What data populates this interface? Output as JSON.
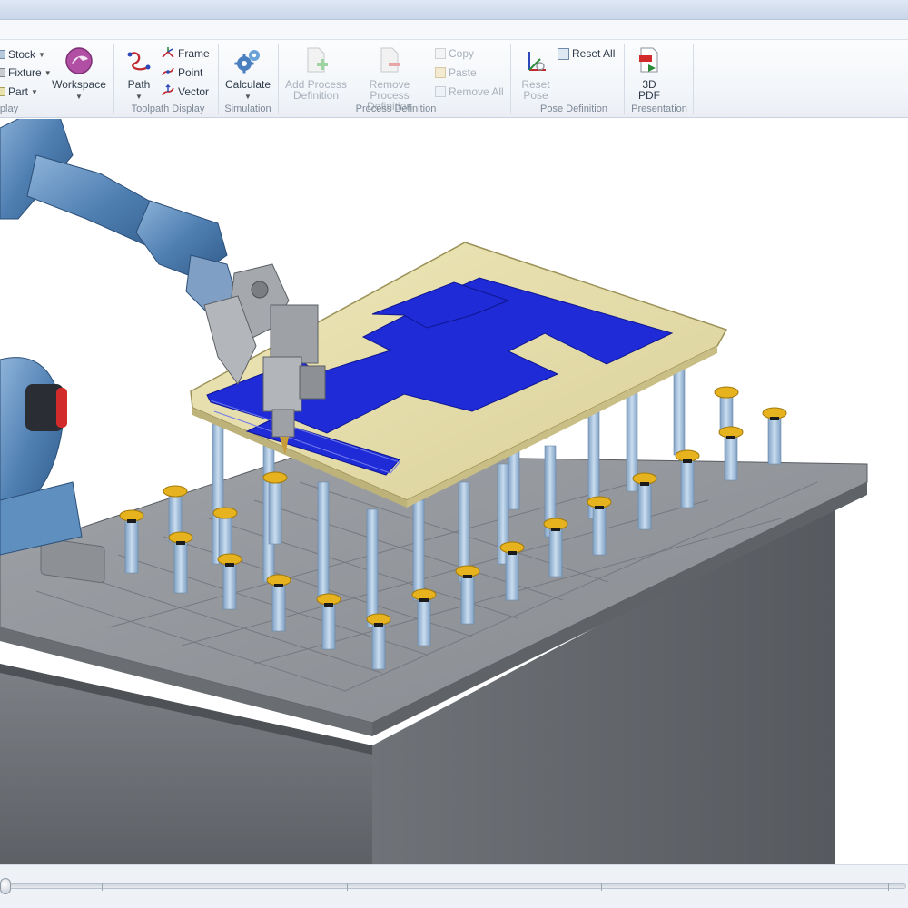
{
  "ribbon": {
    "groups": {
      "display": {
        "label": "play",
        "stock_label": "Stock",
        "fixture_label": "Fixture",
        "part_label": "Part",
        "workspace_label": "Workspace"
      },
      "toolpath_display": {
        "label": "Toolpath Display",
        "path_label": "Path",
        "frame_label": "Frame",
        "point_label": "Point",
        "vector_label": "Vector"
      },
      "simulation": {
        "label": "Simulation",
        "calculate_label": "Calculate"
      },
      "process_definition": {
        "label": "Process Definition",
        "add_line1": "Add Process",
        "add_line2": "Definition",
        "remove_line1": "Remove Process",
        "remove_line2": "Definition",
        "copy_label": "Copy",
        "paste_label": "Paste",
        "remove_all_label": "Remove All"
      },
      "pose_definition": {
        "label": "Pose Definition",
        "reset_pose_line1": "Reset",
        "reset_pose_line2": "Pose",
        "reset_all_label": "Reset All"
      },
      "presentation": {
        "label": "Presentation",
        "pdf_line1": "3D",
        "pdf_line2": "PDF"
      }
    }
  },
  "colors": {
    "accent_blue": "#1f2bd6",
    "panel_tan": "#e3dba4",
    "fixture_gray": "#8a8e93",
    "pin_blue": "#9fbedb",
    "cup_yellow": "#e6b21e",
    "robot_blue": "#5a86b6"
  },
  "icons": {
    "workspace": "workspace-icon",
    "calculate": "gears-icon",
    "path": "path-icon",
    "frame": "frame-icon",
    "point": "point-icon",
    "vector": "vector-icon",
    "pdf": "pdf-icon"
  }
}
